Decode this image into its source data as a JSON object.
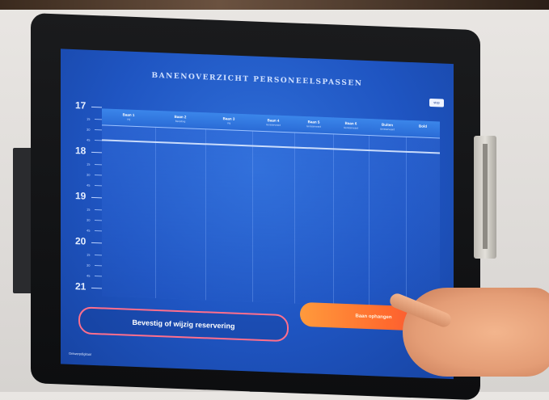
{
  "screen": {
    "title": "BANENOVERZICHT PERSONEELSPASSEN",
    "stop_button": "stop",
    "hours": [
      "17",
      "18",
      "19",
      "20",
      "21"
    ],
    "minutes": [
      "15",
      "30",
      "45"
    ],
    "columns": [
      {
        "name": "Baan 1",
        "sub": "Vrij"
      },
      {
        "name": "Baan 2",
        "sub": "Bezetting"
      },
      {
        "name": "Baan 3",
        "sub": "Vrij"
      },
      {
        "name": "Baan 4",
        "sub": "Gereserveerd"
      },
      {
        "name": "Baan 5",
        "sub": "Gereserveerd"
      },
      {
        "name": "Baan 6",
        "sub": "Gereserveerd"
      },
      {
        "name": "Buiten",
        "sub": "Gereserveerd"
      },
      {
        "name": "Bold",
        "sub": ""
      }
    ],
    "confirm_button": "Bevestig of wijzig reservering",
    "hang_button": "Baan ophangen",
    "footer": "Ontwerpdigitaal"
  },
  "colors": {
    "screen_blue": "#1f55c2",
    "accent_orange": "#ff6a2e",
    "accent_pink": "#ff6f8c"
  }
}
